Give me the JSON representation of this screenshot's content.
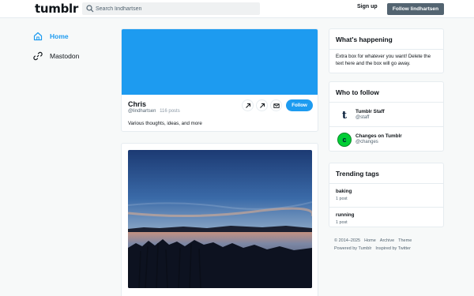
{
  "header": {
    "logo": "tumblr",
    "search_placeholder": "Search lindhartsen",
    "signup_label": "Sign up",
    "follow_label": "Follow lindhartsen"
  },
  "nav": {
    "items": [
      {
        "label": "Home",
        "icon": "home-icon"
      },
      {
        "label": "Mastodon",
        "icon": "link-icon"
      }
    ]
  },
  "profile": {
    "name": "Chris",
    "handle": "@lindhartsen",
    "posts": "116 posts",
    "bio": "Various thoughts, ideas, and more",
    "follow_label": "Follow",
    "banner_color": "#1d9bf0"
  },
  "sidebar": {
    "happening_title": "What's happening",
    "happening_text": "Extra box for whatever you want! Delete the text here and the box will go away.",
    "who_title": "Who to follow",
    "who": [
      {
        "name": "Tumblr Staff",
        "handle": "@staff",
        "avatar": "t"
      },
      {
        "name": "Changes on Tumblr",
        "handle": "@changes",
        "avatar": "c"
      }
    ],
    "trending_title": "Trending tags",
    "trending": [
      {
        "tag": "baking",
        "count": "1 post"
      },
      {
        "tag": "running",
        "count": "1 post"
      }
    ]
  },
  "footer": {
    "line1": [
      "© 2014–2025",
      "Home",
      "Archive",
      "Theme"
    ],
    "line2": [
      "Powered by Tumblr",
      "Inspired by Twitter"
    ]
  },
  "colors": {
    "accent": "#1d9bf0",
    "follow_top_bg": "#536471",
    "changes_green": "#00cf35"
  }
}
